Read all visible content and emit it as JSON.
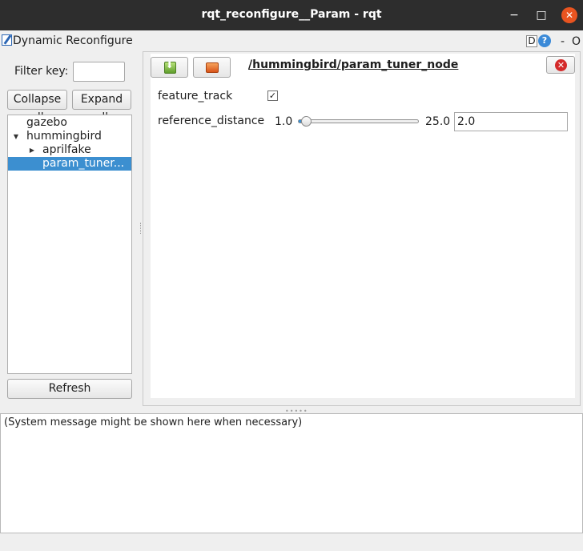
{
  "window": {
    "title": "rqt_reconfigure__Param - rqt",
    "minimize": "−",
    "maximize": "□",
    "close": "✕"
  },
  "plugin": {
    "title": "Dynamic Reconfigure",
    "d_label": "D",
    "help_label": "?",
    "dash_label": "-",
    "o_label": "O"
  },
  "left": {
    "filter_label": "Filter key:",
    "filter_value": "",
    "collapse_label": "Collapse all",
    "expand_label": "Expand all",
    "tree": [
      {
        "label": "gazebo",
        "level": 0,
        "arrow": ""
      },
      {
        "label": "hummingbird",
        "level": 0,
        "arrow": "▼"
      },
      {
        "label": "aprilfake",
        "level": 1,
        "arrow": "▶"
      },
      {
        "label": "param_tuner...",
        "level": 1,
        "arrow": "",
        "selected": true
      }
    ],
    "refresh_label": "Refresh"
  },
  "node": {
    "path": "/hummingbird/param_tuner_node",
    "icons": {
      "save": "download-icon",
      "load": "folder-icon",
      "close": "close-icon"
    },
    "params": {
      "feature_track": {
        "label": "feature_track",
        "checked": true,
        "check_mark": "✓"
      },
      "reference_distance": {
        "label": "reference_distance",
        "min": "1.0",
        "max": "25.0",
        "value": "2.0",
        "fraction": 0.042
      }
    }
  },
  "message": {
    "text": "(System message might be shown here when necessary)"
  },
  "colors": {
    "titlebar": "#2d2d2d",
    "close_button": "#e95420",
    "selection": "#3c8fd0",
    "node_close": "#d42a2a"
  }
}
